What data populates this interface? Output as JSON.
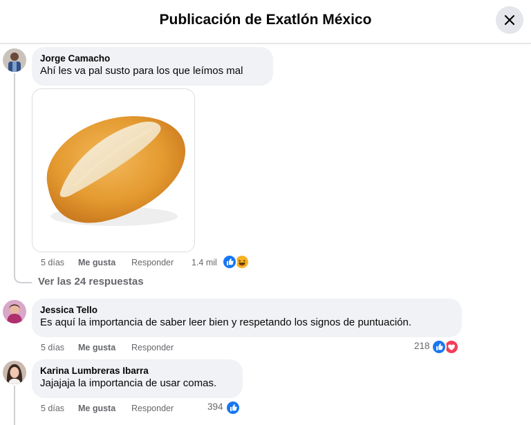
{
  "header": {
    "title": "Publicación de Exatlón México"
  },
  "comments": [
    {
      "author": "Jorge Camacho",
      "text": "Ahí les va pal susto para los que leímos mal",
      "time": "5 días",
      "like_label": "Me gusta",
      "reply_label": "Responder",
      "reactions": "1.4 mil",
      "reaction_icons": [
        "like-icon",
        "haha-icon"
      ]
    },
    {
      "author": "Jessica Tello",
      "text": "Es aquí la importancia de saber leer bien y respetando los signos de puntuación.",
      "time": "5 días",
      "like_label": "Me gusta",
      "reply_label": "Responder",
      "reactions": "218",
      "reaction_icons": [
        "like-icon",
        "love-icon"
      ]
    },
    {
      "author": "Karina Lumbreras Ibarra",
      "text": "Jajajaja la importancia de usar comas.",
      "time": "5 días",
      "like_label": "Me gusta",
      "reply_label": "Responder",
      "reactions": "394",
      "reaction_icons": [
        "like-icon"
      ]
    }
  ],
  "replies_link": "Ver las 24 respuestas",
  "colors": {
    "like": "#1877f2",
    "love": "#f33e58",
    "haha": "#f7b125",
    "bubble": "#f0f2f5"
  }
}
